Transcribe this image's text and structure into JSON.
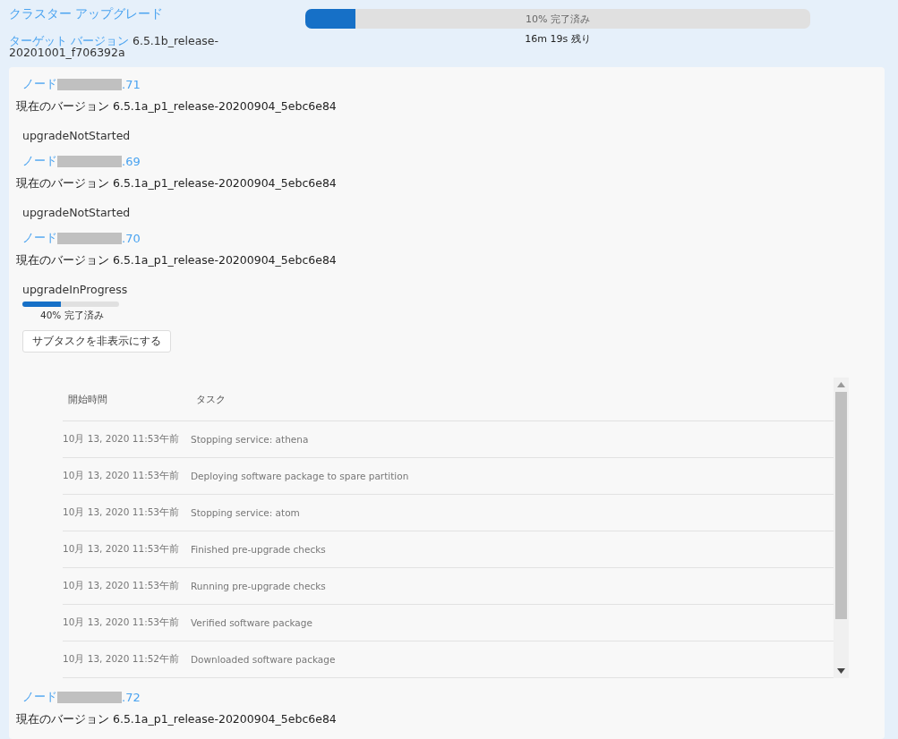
{
  "header": {
    "title": "クラスター アップグレード",
    "target_label": "ターゲット バージョン",
    "target_version": "6.5.1b_release-20201001_f706392a",
    "progress": {
      "level": 0.1,
      "label": "10% 完了済み",
      "remaining": "16m 19s 残り"
    }
  },
  "nodes": [
    {
      "label": "ノード",
      "suffix": ".71",
      "version_label": "現在のバージョン",
      "version": "6.5.1a_p1_release-20200904_5ebc6e84",
      "status": "upgradeNotStarted"
    },
    {
      "label": "ノード",
      "suffix": ".69",
      "version_label": "現在のバージョン",
      "version": "6.5.1a_p1_release-20200904_5ebc6e84",
      "status": "upgradeNotStarted"
    },
    {
      "label": "ノード",
      "suffix": ".70",
      "version_label": "現在のバージョン",
      "version": "6.5.1a_p1_release-20200904_5ebc6e84",
      "status": "upgradeInProgress",
      "progress": {
        "level": 0.4,
        "label": "40% 完了済み"
      },
      "toggle_button": "サブタスクを非表示にする",
      "subtasks": {
        "columns": [
          "開始時間",
          "タスク"
        ],
        "rows": [
          [
            "10月 13, 2020 11:53午前",
            "Stopping service: athena"
          ],
          [
            "10月 13, 2020 11:53午前",
            "Deploying software package to spare partition"
          ],
          [
            "10月 13, 2020 11:53午前",
            "Stopping service: atom"
          ],
          [
            "10月 13, 2020 11:53午前",
            "Finished pre-upgrade checks"
          ],
          [
            "10月 13, 2020 11:53午前",
            "Running pre-upgrade checks"
          ],
          [
            "10月 13, 2020 11:53午前",
            "Verified software package"
          ],
          [
            "10月 13, 2020 11:52午前",
            "Downloaded software package"
          ]
        ]
      }
    },
    {
      "label": "ノード",
      "suffix": ".72",
      "version_label": "現在のバージョン",
      "version": "6.5.1a_p1_release-20200904_5ebc6e84"
    }
  ]
}
